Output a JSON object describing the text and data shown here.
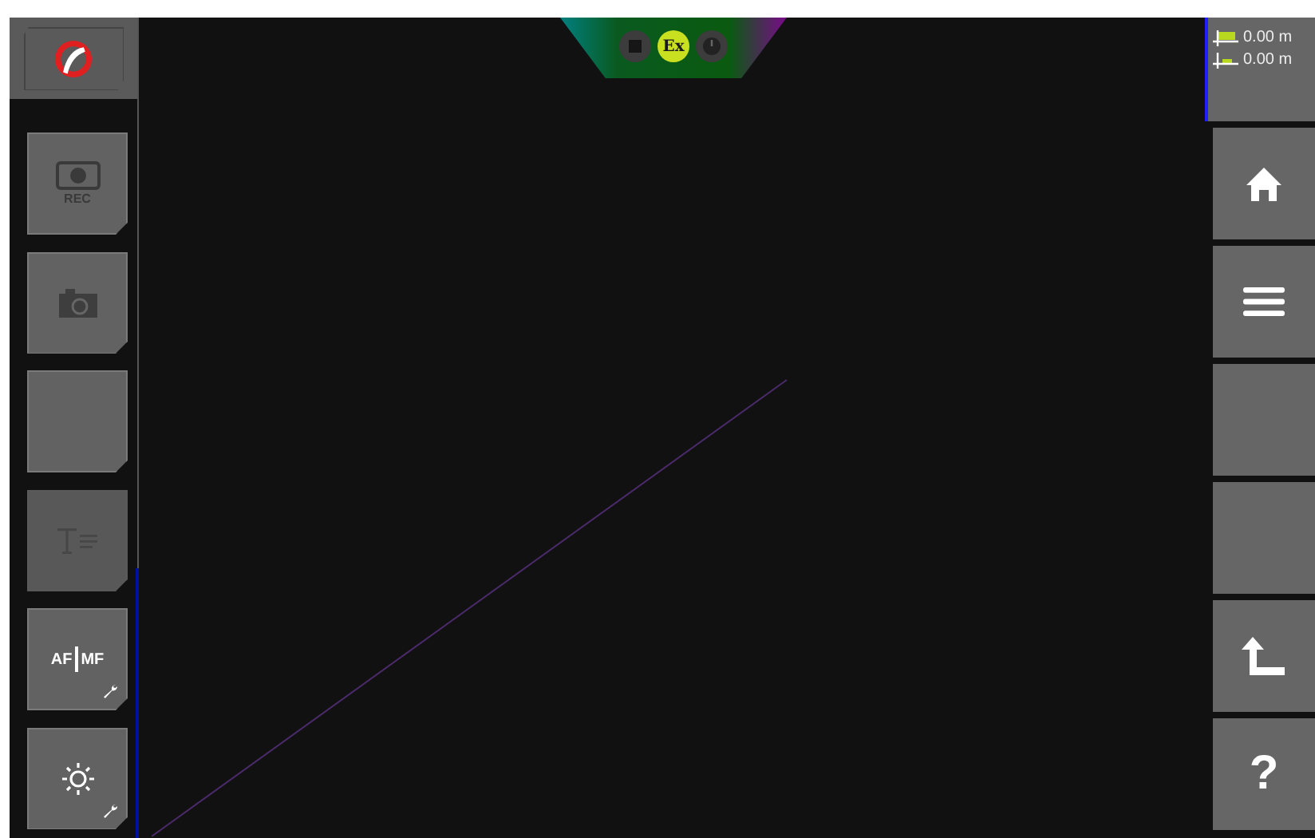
{
  "top_bar": {
    "items": [
      {
        "kind": "stop",
        "active": false
      },
      {
        "kind": "ex",
        "label": "Ex",
        "active": true
      },
      {
        "kind": "gauge",
        "active": false
      }
    ]
  },
  "left_buttons": [
    {
      "kind": "rec",
      "label": "REC",
      "disabled": false
    },
    {
      "kind": "camera",
      "disabled": false
    },
    {
      "kind": "blank",
      "disabled": false
    },
    {
      "kind": "text",
      "disabled": true
    },
    {
      "kind": "afmf",
      "labels": [
        "AF",
        "MF"
      ],
      "disabled": false
    },
    {
      "kind": "brightness",
      "disabled": false
    }
  ],
  "readouts": [
    {
      "kind": "upper",
      "value": "0.00 m"
    },
    {
      "kind": "lower",
      "value": "0.00 m"
    }
  ],
  "right_buttons": [
    {
      "kind": "home"
    },
    {
      "kind": "menu"
    },
    {
      "kind": "blank"
    },
    {
      "kind": "blank"
    },
    {
      "kind": "back"
    },
    {
      "kind": "help",
      "label": "?"
    }
  ]
}
